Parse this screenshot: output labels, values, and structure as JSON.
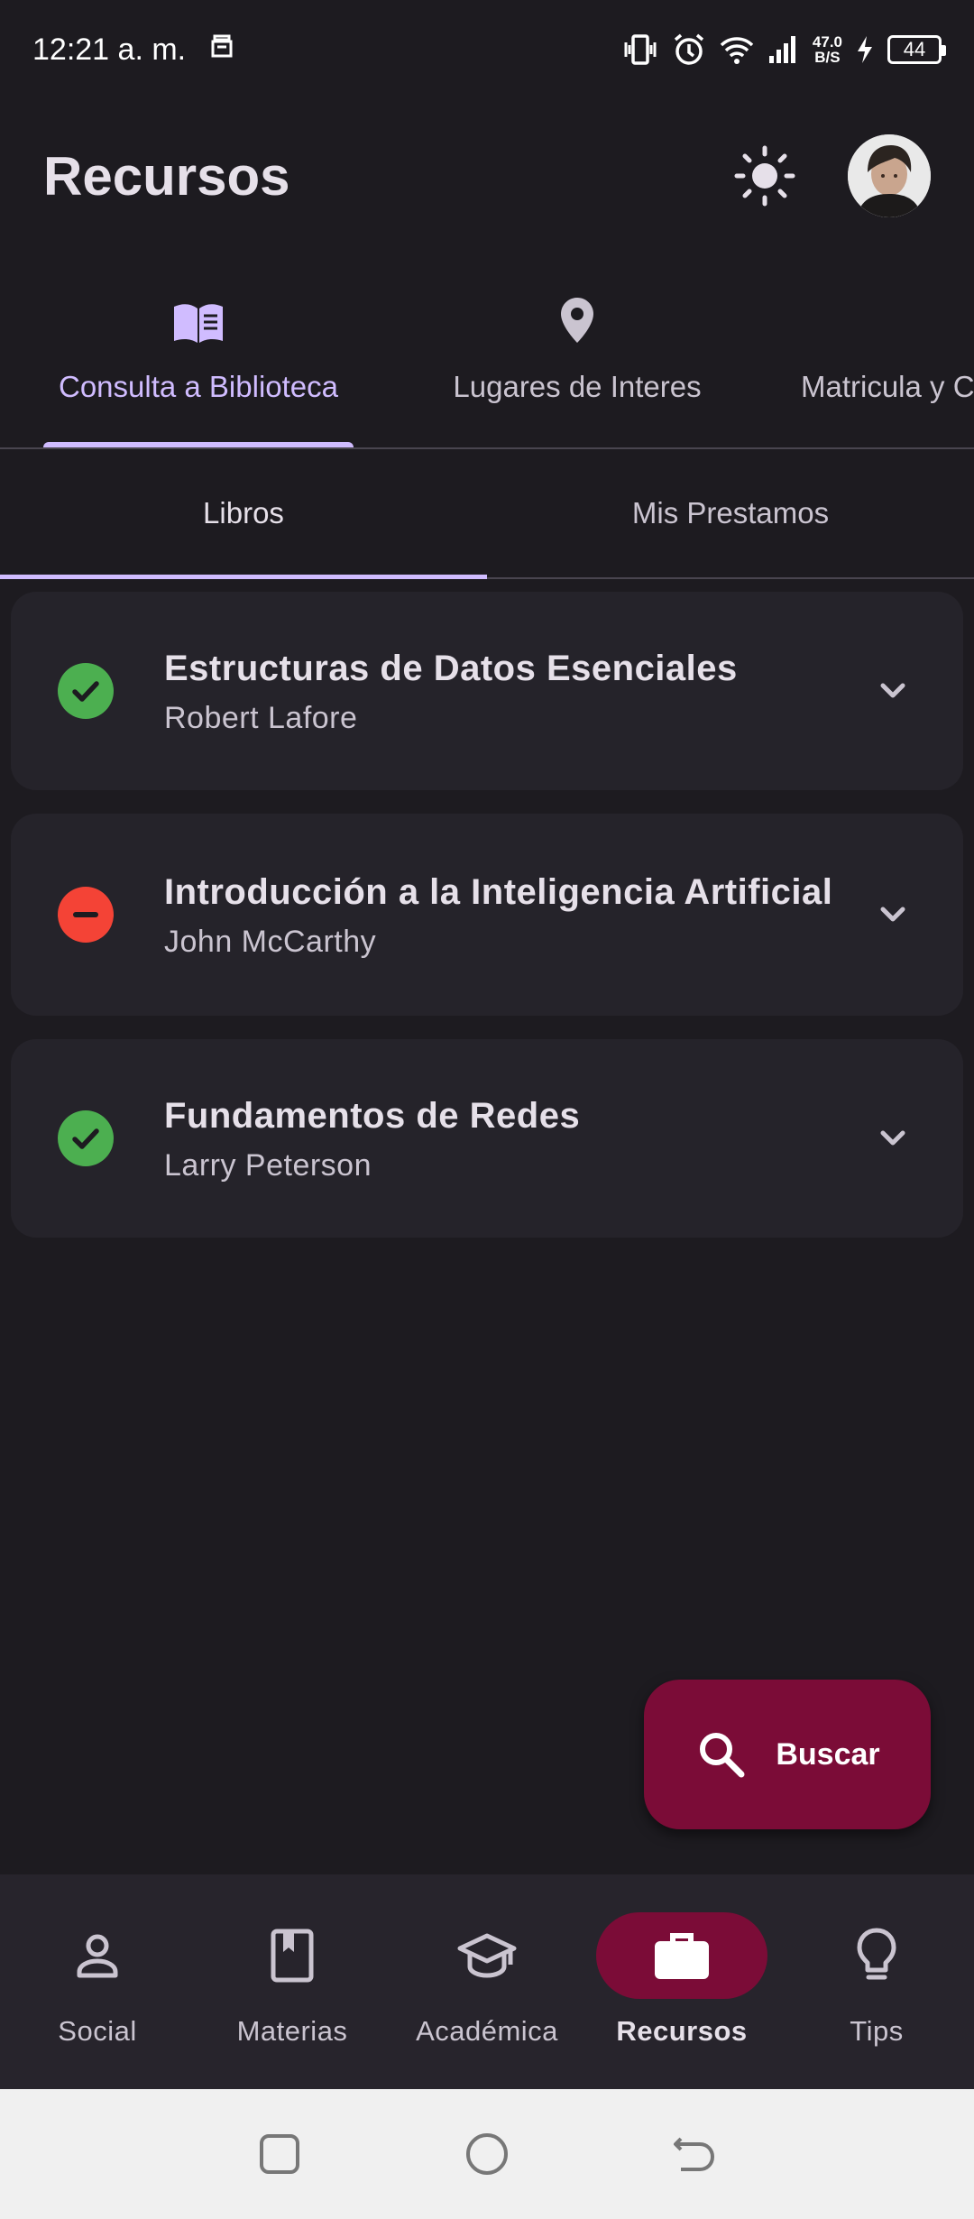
{
  "status_bar": {
    "time": "12:21 a. m.",
    "net_speed_value": "47.0",
    "net_speed_unit": "B/S",
    "battery": "44"
  },
  "header": {
    "title": "Recursos"
  },
  "primary_tabs": [
    {
      "label": "Consulta a Biblioteca",
      "icon": "library-book-icon",
      "active": true
    },
    {
      "label": "Lugares de Interes",
      "icon": "location-pin-icon",
      "active": false
    },
    {
      "label": "Matricula y C",
      "icon": "doc-icon",
      "active": false
    }
  ],
  "secondary_tabs": [
    {
      "label": "Libros",
      "active": true
    },
    {
      "label": "Mis Prestamos",
      "active": false
    }
  ],
  "books": [
    {
      "title": "Estructuras de Datos Esenciales",
      "author": "Robert Lafore",
      "status": "available"
    },
    {
      "title": "Introducción a la Inteligencia Artificial",
      "author": "John McCarthy",
      "status": "unavailable"
    },
    {
      "title": "Fundamentos de Redes",
      "author": "Larry Peterson",
      "status": "available"
    }
  ],
  "fab": {
    "label": "Buscar",
    "icon": "search-icon"
  },
  "bottom_nav": [
    {
      "label": "Social",
      "icon": "person-icon",
      "active": false
    },
    {
      "label": "Materias",
      "icon": "book-icon",
      "active": false
    },
    {
      "label": "Académica",
      "icon": "graduation-cap-icon",
      "active": false
    },
    {
      "label": "Recursos",
      "icon": "briefcase-icon",
      "active": true
    },
    {
      "label": "Tips",
      "icon": "lightbulb-icon",
      "active": false
    }
  ],
  "colors": {
    "background": "#1d1b20",
    "accent": "#d0bcff",
    "primary_container": "#7b0c37",
    "available": "#4caf50",
    "unavailable": "#f44336"
  }
}
